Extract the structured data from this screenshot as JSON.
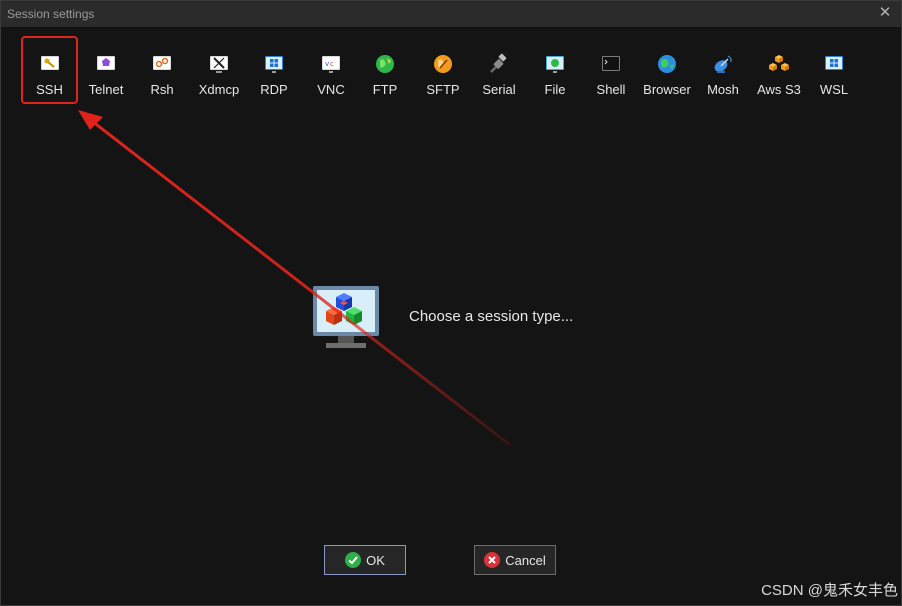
{
  "window": {
    "title": "Session settings",
    "close_glyph": "✕"
  },
  "session_types": [
    {
      "label": "SSH",
      "icon": "ssh-key-icon",
      "selected": true
    },
    {
      "label": "Telnet",
      "icon": "telnet-icon"
    },
    {
      "label": "Rsh",
      "icon": "rsh-icon"
    },
    {
      "label": "Xdmcp",
      "icon": "xdmcp-icon"
    },
    {
      "label": "RDP",
      "icon": "rdp-icon"
    },
    {
      "label": "VNC",
      "icon": "vnc-icon"
    },
    {
      "label": "FTP",
      "icon": "ftp-globe-icon"
    },
    {
      "label": "SFTP",
      "icon": "sftp-globe-icon"
    },
    {
      "label": "Serial",
      "icon": "serial-plug-icon"
    },
    {
      "label": "File",
      "icon": "file-monitor-icon"
    },
    {
      "label": "Shell",
      "icon": "shell-terminal-icon"
    },
    {
      "label": "Browser",
      "icon": "browser-globe-icon"
    },
    {
      "label": "Mosh",
      "icon": "mosh-satellite-icon"
    },
    {
      "label": "Aws S3",
      "icon": "aws-s3-cubes-icon"
    },
    {
      "label": "WSL",
      "icon": "wsl-windows-icon"
    }
  ],
  "main": {
    "prompt": "Choose a session type..."
  },
  "buttons": {
    "ok_label": "OK",
    "cancel_label": "Cancel"
  },
  "watermark": "CSDN @鬼禾女丰色",
  "colors": {
    "highlight": "#e0241c",
    "arrow": "#e0241c",
    "ok_icon": "#2fae49",
    "cancel_icon": "#d9323a"
  }
}
